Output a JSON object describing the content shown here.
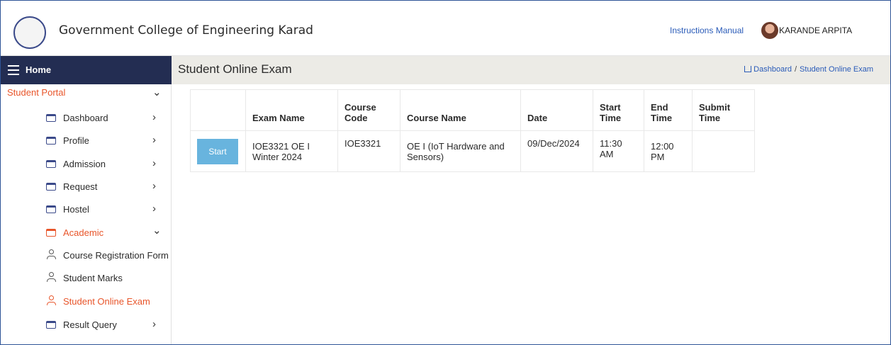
{
  "header": {
    "college_name": "Government College of Engineering Karad",
    "manual_link": "Instructions Manual",
    "user_name": "KARANDE ARPITA"
  },
  "sidebar": {
    "home_label": "Home",
    "portal_label": "Student Portal",
    "items": [
      {
        "label": "Dashboard",
        "icon": "folder-icon"
      },
      {
        "label": "Profile",
        "icon": "folder-icon"
      },
      {
        "label": "Admission",
        "icon": "folder-icon"
      },
      {
        "label": "Request",
        "icon": "folder-icon"
      },
      {
        "label": "Hostel",
        "icon": "folder-icon"
      },
      {
        "label": "Academic",
        "icon": "folder-icon"
      },
      {
        "label": "Course Registration Form",
        "icon": "user-icon"
      },
      {
        "label": "Student Marks",
        "icon": "user-icon"
      },
      {
        "label": "Student Online Exam",
        "icon": "user-icon"
      },
      {
        "label": "Result Query",
        "icon": "folder-icon"
      }
    ]
  },
  "page": {
    "title": "Student Online Exam",
    "breadcrumb_home": "Dashboard",
    "breadcrumb_sep": "/",
    "breadcrumb_current": "Student Online Exam"
  },
  "table": {
    "headers": [
      "",
      "Exam Name",
      "Course Code",
      "Course Name",
      "Date",
      "Start Time",
      "End Time",
      "Submit Time"
    ],
    "rows": [
      {
        "action": "Start",
        "exam_name": "IOE3321 OE I Winter 2024",
        "course_code": "IOE3321",
        "course_name": "OE I (IoT Hardware and Sensors)",
        "date": "09/Dec/2024",
        "start_time": "11:30 AM",
        "end_time": "12:00 PM",
        "submit_time": ""
      }
    ]
  },
  "colors": {
    "accent_orange": "#e8552a",
    "nav_dark": "#232d52",
    "link_blue": "#2a5bb8",
    "button_blue": "#68b4de"
  }
}
